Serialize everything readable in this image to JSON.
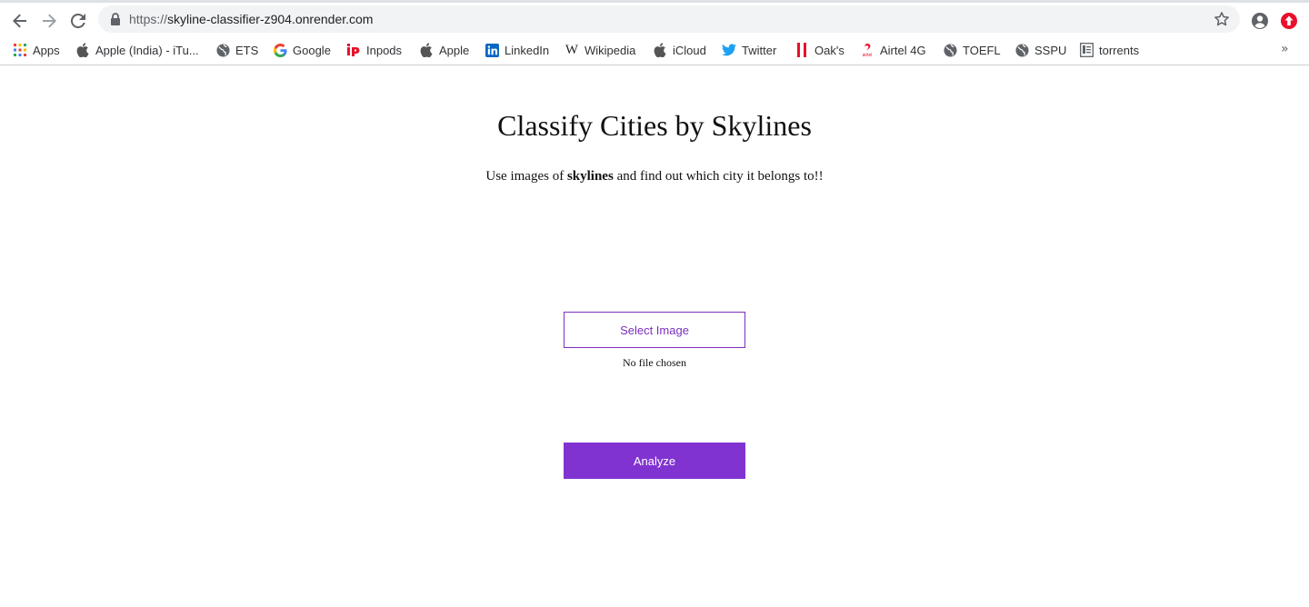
{
  "browser": {
    "url_scheme": "https://",
    "url_host": "skyline-classifier-z904.onrender.com"
  },
  "bookmarks": [
    {
      "label": "Apps",
      "icon": "apps-grid-icon"
    },
    {
      "label": "Apple (India) - iTu...",
      "icon": "apple-icon"
    },
    {
      "label": "ETS",
      "icon": "globe-icon"
    },
    {
      "label": "Google",
      "icon": "google-icon"
    },
    {
      "label": "Inpods",
      "icon": "inpods-icon"
    },
    {
      "label": "Apple",
      "icon": "apple-icon"
    },
    {
      "label": "LinkedIn",
      "icon": "linkedin-icon"
    },
    {
      "label": "Wikipedia",
      "icon": "wikipedia-icon"
    },
    {
      "label": "iCloud",
      "icon": "apple-icon"
    },
    {
      "label": "Twitter",
      "icon": "twitter-icon"
    },
    {
      "label": "Oak's",
      "icon": "oaks-icon"
    },
    {
      "label": "Airtel 4G",
      "icon": "airtel-icon"
    },
    {
      "label": "TOEFL",
      "icon": "globe-icon"
    },
    {
      "label": "SSPU",
      "icon": "globe-icon"
    },
    {
      "label": "torrents",
      "icon": "document-icon"
    }
  ],
  "page": {
    "title": "Classify Cities by Skylines",
    "subtitle_before": "Use images of ",
    "subtitle_bold": "skylines",
    "subtitle_after": " and find out which city it belongs to!!",
    "select_label": "Select Image",
    "file_status": "No file chosen",
    "analyze_label": "Analyze"
  },
  "colors": {
    "accent": "#8133d1",
    "outline_accent": "#7b2fbf"
  }
}
